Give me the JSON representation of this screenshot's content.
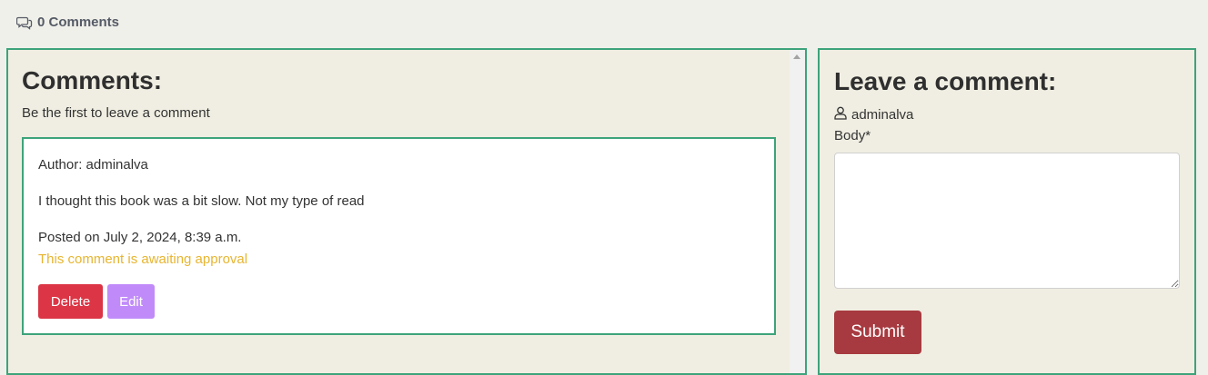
{
  "header": {
    "comments_count_label": "0 Comments",
    "icon": "comments-icon"
  },
  "comments_panel": {
    "title": "Comments:",
    "subtitle": "Be the first to leave a comment",
    "comment": {
      "author": "Author: adminalva",
      "body": "I thought this book was a bit slow. Not my type of read",
      "posted": "Posted on July 2, 2024, 8:39 a.m.",
      "status": "This comment is awaiting approval",
      "delete_label": "Delete",
      "edit_label": "Edit"
    }
  },
  "form_panel": {
    "title": "Leave a comment:",
    "user_icon": "user-icon",
    "username": "adminalva",
    "body_label": "Body*",
    "body_value": "",
    "submit_label": "Submit"
  },
  "colors": {
    "panel_border": "#3da37a",
    "delete": "#dc3545",
    "edit": "#c08bf9",
    "submit": "#a73a40",
    "awaiting": "#e7b530"
  }
}
